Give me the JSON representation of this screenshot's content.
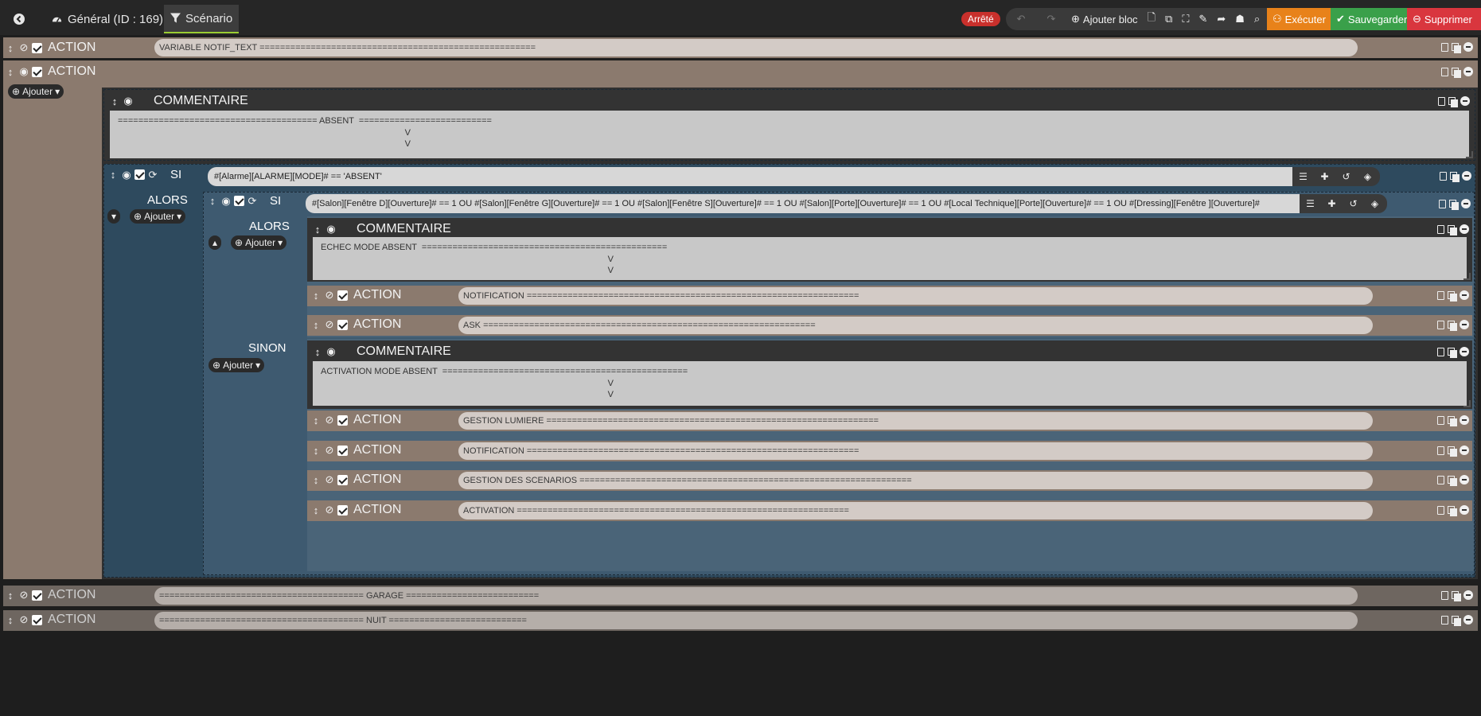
{
  "topbar": {
    "back_icon": "arrow-left-icon",
    "tab_general": "Général (ID : 169)",
    "tab_scenario": "Scénario",
    "status": "Arrêté",
    "add_block": "Ajouter bloc",
    "execute": "Exécuter",
    "save": "Sauvegarder",
    "delete": "Supprimer",
    "colors": {
      "execute": "#e8821a",
      "save": "#3aa04a",
      "delete": "#d9363e",
      "status": "#c9302c"
    }
  },
  "labels": {
    "action": "ACTION",
    "commentaire": "COMMENTAIRE",
    "si": "SI",
    "alors": "ALORS",
    "sinon": "SINON",
    "ajouter": "Ajouter"
  },
  "rows": {
    "r1": "VARIABLE NOTIF_TEXT ======================================================",
    "comment1": "======================================= ABSENT  ==========================\n                                                                                                                      V\n                                                                                                                      V",
    "si1": "#[Alarme][ALARME][MODE]# == 'ABSENT'",
    "si2": "#[Salon][Fenêtre D][Ouverture]# == 1  OU #[Salon][Fenêtre G][Ouverture]# == 1  OU #[Salon][Fenêtre S][Ouverture]# == 1  OU #[Salon][Porte][Ouverture]# == 1  OU #[Local Technique][Porte][Ouverture]# == 1  OU #[Dressing][Fenêtre ][Ouverture]#",
    "comment2": "ECHEC MODE ABSENT  ================================================\n                                                                                                                      V\n                                                                                                                      V",
    "a_notification1": "NOTIFICATION =================================================================",
    "a_ask": "ASK =================================================================",
    "comment3": "ACTIVATION MODE ABSENT  ================================================\n                                                                                                                      V\n                                                                                                                      V",
    "a_lumiere": "GESTION LUMIERE =================================================================",
    "a_notification2": "NOTIFICATION =================================================================",
    "a_scenarios": "GESTION DES SCENARIOS =================================================================",
    "a_activation": "ACTIVATION =================================================================",
    "garage": "======================================== GARAGE ==========================",
    "nuit": "======================================== NUIT ==========================="
  }
}
